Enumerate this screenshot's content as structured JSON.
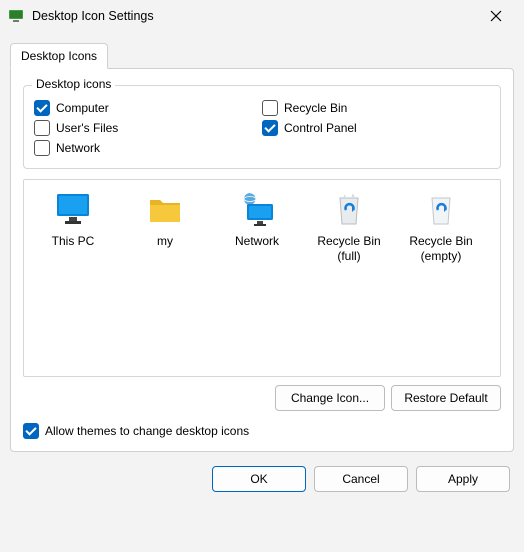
{
  "window": {
    "title": "Desktop Icon Settings"
  },
  "tabs": {
    "active": "Desktop Icons"
  },
  "group": {
    "legend": "Desktop icons",
    "items": {
      "computer": {
        "label": "Computer",
        "checked": true
      },
      "users_files": {
        "label": "User's Files",
        "checked": false
      },
      "network": {
        "label": "Network",
        "checked": false
      },
      "recycle_bin": {
        "label": "Recycle Bin",
        "checked": false
      },
      "control_panel": {
        "label": "Control Panel",
        "checked": true
      }
    }
  },
  "preview": {
    "this_pc": "This PC",
    "my": "my",
    "network": "Network",
    "recycle_full": "Recycle Bin (full)",
    "recycle_empty": "Recycle Bin (empty)"
  },
  "buttons": {
    "change_icon": "Change Icon...",
    "restore_default": "Restore Default",
    "ok": "OK",
    "cancel": "Cancel",
    "apply": "Apply"
  },
  "allow_themes": {
    "label": "Allow themes to change desktop icons",
    "checked": true
  }
}
